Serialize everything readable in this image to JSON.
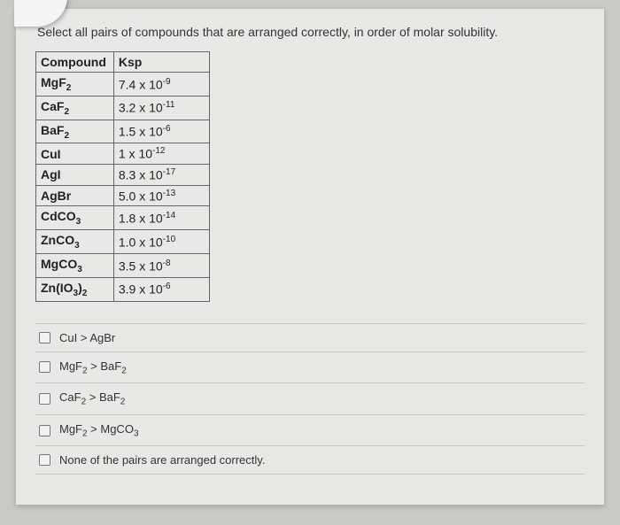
{
  "question": "Select all pairs of compounds that are arranged correctly, in order of molar solubility.",
  "table": {
    "headers": [
      "Compound",
      "Ksp"
    ],
    "rows": [
      {
        "compound_html": "MgF<span class='sub'>2</span>",
        "ksp_html": "7.4 x 10<span class='sup'>-9</span>"
      },
      {
        "compound_html": "CaF<span class='sub'>2</span>",
        "ksp_html": "3.2 x 10<span class='sup'>-11</span>"
      },
      {
        "compound_html": "BaF<span class='sub'>2</span>",
        "ksp_html": "1.5 x 10<span class='sup'>-6</span>"
      },
      {
        "compound_html": "CuI",
        "ksp_html": "1 x 10<span class='sup'>-12</span>"
      },
      {
        "compound_html": "AgI",
        "ksp_html": "8.3 x 10<span class='sup'>-17</span>"
      },
      {
        "compound_html": "AgBr",
        "ksp_html": "5.0 x 10<span class='sup'>-13</span>"
      },
      {
        "compound_html": "CdCO<span class='sub'>3</span>",
        "ksp_html": "1.8 x 10<span class='sup'>-14</span>"
      },
      {
        "compound_html": "ZnCO<span class='sub'>3</span>",
        "ksp_html": "1.0 x 10<span class='sup'>-10</span>"
      },
      {
        "compound_html": "MgCO<span class='sub'>3</span>",
        "ksp_html": "3.5 x 10<span class='sup'>-8</span>"
      },
      {
        "compound_html": "Zn(IO<span class='sub'>3</span>)<span class='sub'>2</span>",
        "ksp_html": "3.9 x 10<span class='sup'>-6</span>"
      }
    ]
  },
  "options": [
    {
      "label_html": "CuI > AgBr"
    },
    {
      "label_html": "MgF<span class='sub'>2</span> > BaF<span class='sub'>2</span>"
    },
    {
      "label_html": "CaF<span class='sub'>2</span> > BaF<span class='sub'>2</span>"
    },
    {
      "label_html": "MgF<span class='sub'>2</span> > MgCO<span class='sub'>3</span>"
    },
    {
      "label_html": "None of the pairs are arranged correctly."
    }
  ],
  "chart_data": {
    "type": "table",
    "title": "Ksp values by compound",
    "columns": [
      "Compound",
      "Ksp"
    ],
    "rows": [
      [
        "MgF2",
        7.4e-09
      ],
      [
        "CaF2",
        3.2e-11
      ],
      [
        "BaF2",
        1.5e-06
      ],
      [
        "CuI",
        1e-12
      ],
      [
        "AgI",
        8.3e-17
      ],
      [
        "AgBr",
        5e-13
      ],
      [
        "CdCO3",
        1.8e-14
      ],
      [
        "ZnCO3",
        1e-10
      ],
      [
        "MgCO3",
        3.5e-08
      ],
      [
        "Zn(IO3)2",
        3.9e-06
      ]
    ]
  }
}
